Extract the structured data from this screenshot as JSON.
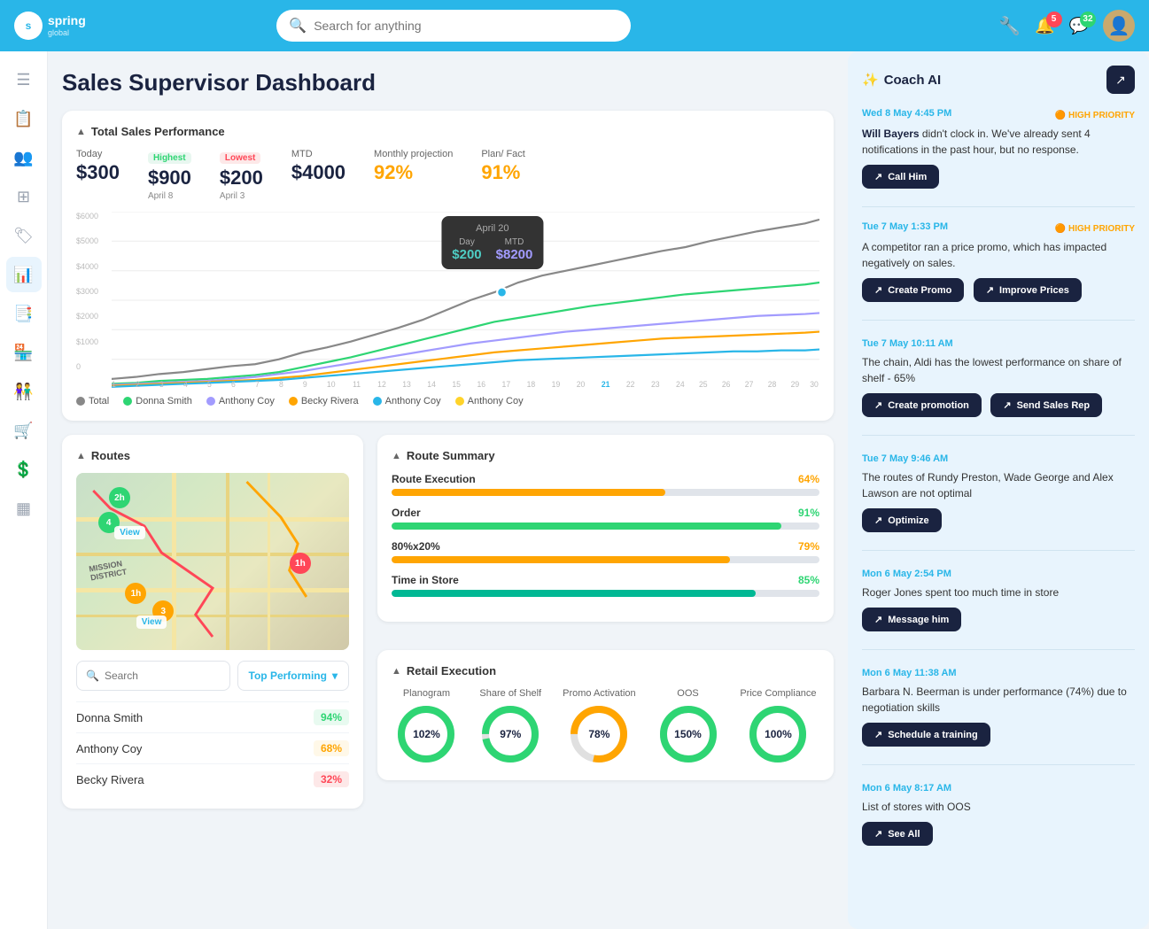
{
  "app": {
    "name": "spring",
    "subtitle": "global"
  },
  "nav": {
    "search_placeholder": "Search for anything",
    "notifications_count": "5",
    "messages_count": "32"
  },
  "page": {
    "title": "Sales Supervisor Dashboard"
  },
  "sales_performance": {
    "section_title": "Total Sales Performance",
    "today_label": "Today",
    "today_value": "$300",
    "highest_label": "Highest",
    "highest_badge": "Highest",
    "highest_value": "$900",
    "highest_date": "April 8",
    "lowest_label": "Lowest",
    "lowest_badge": "Lowest",
    "lowest_value": "$200",
    "lowest_date": "April 3",
    "mtd_label": "MTD",
    "mtd_value": "$4000",
    "monthly_proj_label": "Monthly projection",
    "monthly_proj_value": "92%",
    "plan_fact_label": "Plan/ Fact",
    "plan_fact_value": "91%",
    "tooltip": {
      "date": "April 20",
      "day_label": "Day",
      "day_value": "$200",
      "mtd_label": "MTD",
      "mtd_value": "$8200"
    },
    "legend": [
      {
        "name": "Total",
        "color": "#888"
      },
      {
        "name": "Donna Smith",
        "color": "#2ed573"
      },
      {
        "name": "Anthony Coy",
        "color": "#a29bfe"
      },
      {
        "name": "Becky Rivera",
        "color": "#ffa502"
      },
      {
        "name": "Anthony Coy",
        "color": "#29b6e8"
      },
      {
        "name": "Anthony Coy",
        "color": "#ffd32a"
      }
    ]
  },
  "routes": {
    "section_title": "Routes",
    "search_placeholder": "Search",
    "top_performing_label": "Top Performing",
    "items": [
      {
        "name": "Donna Smith",
        "pct": "94%",
        "type": "green"
      },
      {
        "name": "Anthony Coy",
        "pct": "68%",
        "type": "yellow"
      },
      {
        "name": "Becky Rivera",
        "pct": "32%",
        "type": "red"
      }
    ]
  },
  "route_summary": {
    "section_title": "Route Summary",
    "items": [
      {
        "label": "Route Execution",
        "value": "64%",
        "fill": 64,
        "color": "yellow"
      },
      {
        "label": "Order",
        "value": "91%",
        "fill": 91,
        "color": "green"
      },
      {
        "label": "80%x20%",
        "value": "79%",
        "fill": 79,
        "color": "yellow"
      },
      {
        "label": "Time in Store",
        "value": "85%",
        "fill": 85,
        "color": "green"
      }
    ]
  },
  "retail_execution": {
    "section_title": "Retail Execution",
    "items": [
      {
        "label": "Planogram",
        "value": "102%",
        "pct": 100,
        "color": "#2ed573",
        "bg": "#e0e0e0"
      },
      {
        "label": "Share of Shelf",
        "value": "97%",
        "pct": 97,
        "color": "#2ed573",
        "bg": "#e0e0e0"
      },
      {
        "label": "Promo Activation",
        "value": "78%",
        "pct": 78,
        "color": "#ffa502",
        "bg": "#e0e0e0"
      },
      {
        "label": "OOS",
        "value": "150%",
        "pct": 100,
        "color": "#2ed573",
        "bg": "#e0e0e0"
      },
      {
        "label": "Price Compliance",
        "value": "100%",
        "pct": 100,
        "color": "#2ed573",
        "bg": "#e0e0e0"
      }
    ]
  },
  "coach_ai": {
    "title": "Coach AI",
    "events": [
      {
        "time": "Wed 8 May 4:45 PM",
        "priority": "HIGH PRIORITY",
        "text_before": "",
        "bold": "Will Bayers",
        "text_after": " didn't clock in. We've already sent 4 notifications in the past hour, but no response.",
        "actions": [
          {
            "label": "Call Him",
            "icon": "↗"
          }
        ]
      },
      {
        "time": "Tue 7 May 1:33 PM",
        "priority": "HIGH PRIORITY",
        "text_before": "A competitor ran a price promo, which has impacted negatively on sales.",
        "bold": "",
        "text_after": "",
        "actions": [
          {
            "label": "Create Promo",
            "icon": "↗"
          },
          {
            "label": "Improve Prices",
            "icon": "↗"
          }
        ]
      },
      {
        "time": "Tue 7 May 10:11 AM",
        "priority": "",
        "text_before": "The chain, Aldi has the lowest performance on share of shelf - 65%",
        "bold": "",
        "text_after": "",
        "actions": [
          {
            "label": "Create promotion",
            "icon": "↗"
          },
          {
            "label": "Send Sales Rep",
            "icon": "↗"
          }
        ]
      },
      {
        "time": "Tue 7 May 9:46 AM",
        "priority": "",
        "text_before": "The routes of Rundy Preston, Wade George and Alex Lawson are not optimal",
        "bold": "",
        "text_after": "",
        "actions": [
          {
            "label": "Optimize",
            "icon": "↗"
          }
        ]
      },
      {
        "time": "Mon 6 May 2:54 PM",
        "priority": "",
        "text_before": "Roger Jones spent too much time in store",
        "bold": "",
        "text_after": "",
        "actions": [
          {
            "label": "Message him",
            "icon": "↗"
          }
        ]
      },
      {
        "time": "Mon 6 May 11:38 AM",
        "priority": "",
        "text_before": "Barbara N. Beerman is under performance (74%) due to negotiation skills",
        "bold": "",
        "text_after": "",
        "actions": [
          {
            "label": "Schedule a training",
            "icon": "↗"
          }
        ]
      },
      {
        "time": "Mon 6 May 8:17 AM",
        "priority": "",
        "text_before": "List of stores with OOS",
        "bold": "",
        "text_after": "",
        "actions": [
          {
            "label": "See All",
            "icon": "↗"
          }
        ]
      }
    ]
  }
}
